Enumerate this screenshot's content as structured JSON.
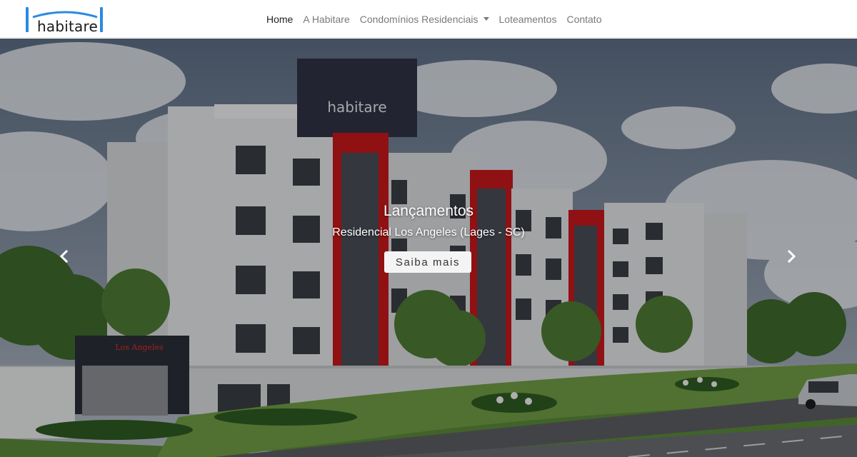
{
  "brand": {
    "name": "habitare",
    "logo_color": "#2a8be0"
  },
  "nav": {
    "items": [
      {
        "label": "Home",
        "active": true
      },
      {
        "label": "A Habitare",
        "active": false
      },
      {
        "label": "Condomínios Residenciais",
        "active": false,
        "dropdown": true
      },
      {
        "label": "Loteamentos",
        "active": false
      },
      {
        "label": "Contato",
        "active": false
      }
    ]
  },
  "carousel": {
    "slide": {
      "title": "Lançamentos",
      "subtitle": "Residencial Los Angeles (Lages - SC)",
      "button_label": "Saiba mais",
      "building_sign": "habitare",
      "entrance_sign": "Los Angeles"
    },
    "prev_icon": "chevron-left-icon",
    "next_icon": "chevron-right-icon",
    "accent_color": "#d41b1b"
  }
}
